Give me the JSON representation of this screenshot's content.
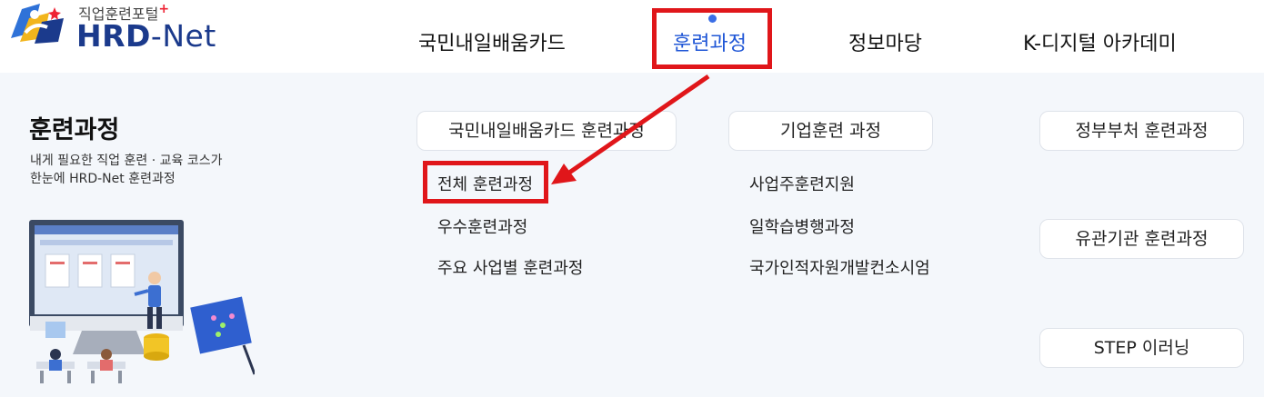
{
  "logo": {
    "subtitle": "직업훈련포털",
    "plus": "+",
    "name_hrd": "HRD",
    "name_dash": "-",
    "name_net": "Net"
  },
  "nav": {
    "items": [
      "국민내일배움카드",
      "훈련과정",
      "정보마당",
      "K-디지털 아카데미"
    ],
    "active_index": 1
  },
  "section": {
    "title": "훈련과정",
    "desc_line1": "내게 필요한 직업 훈련 · 교육 코스가",
    "desc_line2": "한눈에 HRD-Net 훈련과정"
  },
  "categories": {
    "card": "국민내일배움카드 훈련과정",
    "enterprise": "기업훈련 과정",
    "gov": "정부부처 훈련과정",
    "related": "유관기관 훈련과정",
    "step": "STEP 이러닝"
  },
  "card_links": [
    "전체 훈련과정",
    "우수훈련과정",
    "주요 사업별 훈련과정"
  ],
  "enterprise_links": [
    "사업주훈련지원",
    "일학습병행과정",
    "국가인적자원개발컨소시엄"
  ],
  "colors": {
    "highlight": "#e0161a",
    "nav_active": "#1f56d6",
    "panel_bg": "#f4f7fb",
    "logo_blue": "#1b3a8c"
  },
  "icons": [
    "logo-emblem-icon",
    "active-dot-icon",
    "arrow-annotation-icon",
    "classroom-illustration-icon"
  ]
}
